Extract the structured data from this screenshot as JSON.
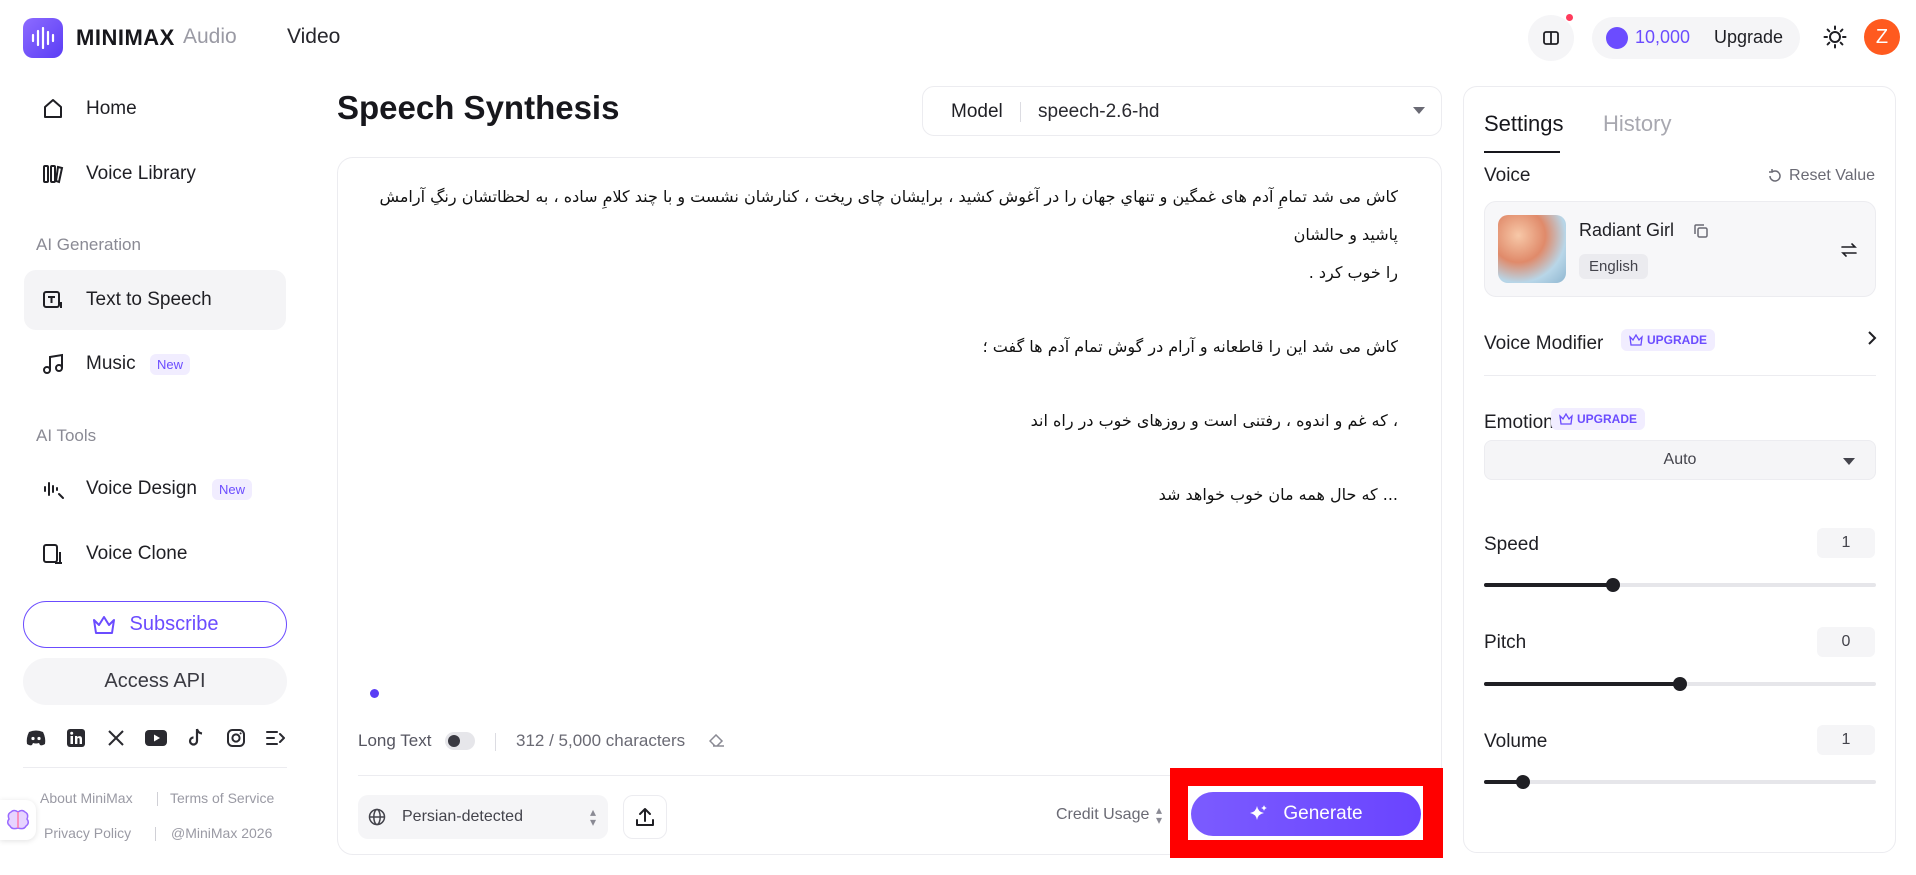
{
  "topbar": {
    "brand": "MINIMAX",
    "nav_audio": "Audio",
    "nav_video": "Video",
    "credits": "10,000",
    "upgrade": "Upgrade",
    "avatar_initial": "Z"
  },
  "sidebar": {
    "home": "Home",
    "voice_library": "Voice Library",
    "section_ai_generation": "AI Generation",
    "text_to_speech": "Text to Speech",
    "music": "Music",
    "music_badge": "New",
    "section_ai_tools": "AI Tools",
    "voice_design": "Voice Design",
    "voice_design_badge": "New",
    "voice_clone": "Voice Clone",
    "subscribe": "Subscribe",
    "access_api": "Access API",
    "social_icons": [
      "discord-icon",
      "linkedin-icon",
      "x-icon",
      "youtube-icon",
      "tiktok-icon",
      "instagram-icon",
      "rednote-icon"
    ],
    "footer": {
      "about": "About MiniMax",
      "terms": "Terms of Service",
      "privacy": "Privacy Policy",
      "copyright": "@MiniMax 2026"
    }
  },
  "main": {
    "title": "Speech Synthesis",
    "model_label": "Model",
    "model_value": "speech-2.6-hd",
    "text_lines": [
      "کاش می شد تمامِ آدم های غمگین و تنهاي جهان را در آغوش کشید ، برایشان چای ریخت ، کنارشان نشست و با چند کلامِ ساده ، به لحظاتشان رنگِ آرامش پاشید و حالشان",
      "را خوب کرد .",
      "کاش می شد این را قاطعانه و آرام در گوش تمام آدم ها گفت ؛",
      "، که غم و اندوه ، رفتنی است و روزهای خوب در راه اند",
      "... که حال همه مان خوب خواهد شد"
    ],
    "long_text_label": "Long Text",
    "char_count": "312 / 5,000 characters",
    "language": "Persian-detected",
    "credit_usage": "Credit Usage",
    "generate": "Generate"
  },
  "settings": {
    "tab_settings": "Settings",
    "tab_history": "History",
    "voice_label": "Voice",
    "reset": "Reset Value",
    "voice_name": "Radiant Girl",
    "voice_lang": "English",
    "voice_modifier": "Voice Modifier",
    "upgrade_tag": "UPGRADE",
    "emotion": "Emotion",
    "emotion_value": "Auto",
    "speed_label": "Speed",
    "speed_value": "1",
    "speed_level": 0.33,
    "pitch_label": "Pitch",
    "pitch_value": "0",
    "pitch_level": 0.5,
    "volume_label": "Volume",
    "volume_value": "1",
    "volume_level": 0.1
  },
  "colors": {
    "accent": "#6b4cff",
    "highlight": "#ff0000"
  }
}
